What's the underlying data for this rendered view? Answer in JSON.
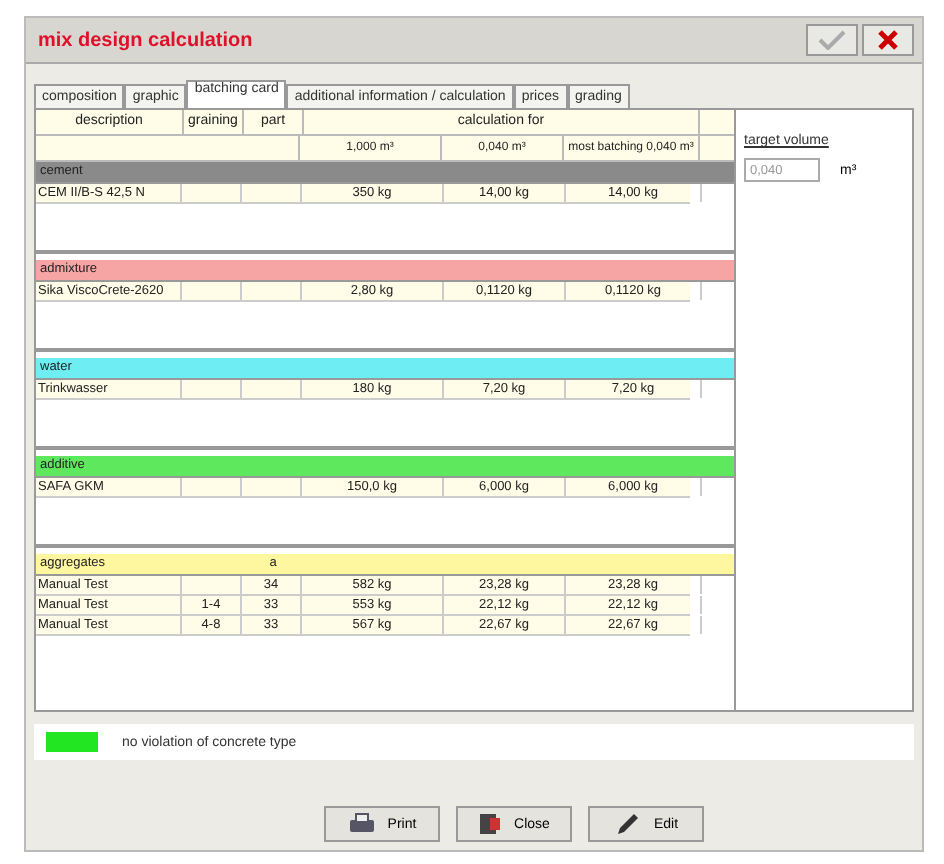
{
  "window": {
    "title": "mix design calculation"
  },
  "tabs": [
    {
      "label": "composition",
      "selected": false
    },
    {
      "label": "graphic",
      "selected": false
    },
    {
      "label": "batching card",
      "selected": true
    },
    {
      "label": "additional information / calculation",
      "selected": false
    },
    {
      "label": "prices",
      "selected": false
    },
    {
      "label": "grading",
      "selected": false
    }
  ],
  "table": {
    "columns": [
      "description",
      "graining",
      "part"
    ],
    "calculation_heading": "calculation for",
    "volumes": [
      "1,000 m³",
      "0,040 m³",
      "most batching 0,040 m³"
    ],
    "groups": [
      {
        "name": "cement",
        "color": "#8a8a8a",
        "rows": [
          {
            "description": "CEM II/B-S 42,5 N",
            "values": [
              "350 kg",
              "14,00 kg",
              "14,00 kg"
            ]
          }
        ]
      },
      {
        "name": "admixture",
        "color": "#f6a4a4",
        "rows": [
          {
            "description": "Sika ViscoCrete-2620",
            "values": [
              "2,80 kg",
              "0,1120 kg",
              "0,1120 kg"
            ]
          }
        ]
      },
      {
        "name": "water",
        "color": "#6eeef2",
        "rows": [
          {
            "description": "Trinkwasser",
            "values": [
              "180 kg",
              "7,20 kg",
              "7,20 kg"
            ]
          }
        ]
      },
      {
        "name": "additive",
        "color": "#5ee85e",
        "rows": [
          {
            "description": "SAFA GKM",
            "values": [
              "150,0 kg",
              "6,000 kg",
              "6,000 kg"
            ]
          }
        ]
      },
      {
        "name": "aggregates",
        "color": "#fff6a0",
        "part": "a",
        "rows": [
          {
            "description": "Manual Test",
            "part": "34",
            "values": [
              "582 kg",
              "23,28 kg",
              "23,28 kg"
            ]
          },
          {
            "description": "Manual Test",
            "graining": "1-4",
            "part": "33",
            "values": [
              "553 kg",
              "22,12 kg",
              "22,12 kg"
            ]
          },
          {
            "description": "Manual Test",
            "graining": "4-8",
            "part": "33",
            "values": [
              "567 kg",
              "22,67 kg",
              "22,67 kg"
            ]
          }
        ]
      }
    ]
  },
  "target_volume": {
    "label": "target volume",
    "value": "0,040",
    "unit": "m³"
  },
  "status": {
    "color": "#22e622",
    "text": "no violation of concrete type"
  },
  "buttons": [
    {
      "label": "Print",
      "kind": "print"
    },
    {
      "label": "Close",
      "kind": "close"
    },
    {
      "label": "Edit",
      "kind": "edit"
    }
  ]
}
